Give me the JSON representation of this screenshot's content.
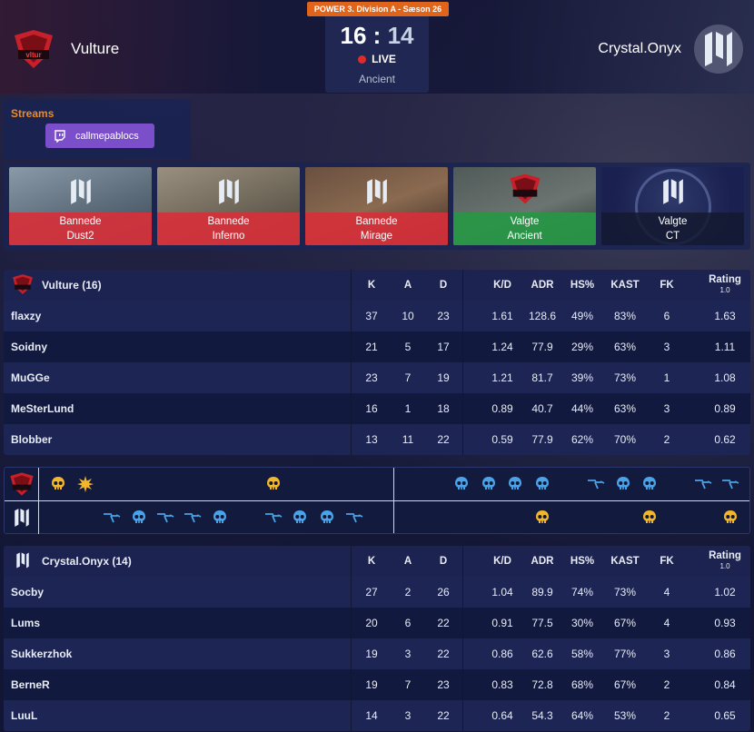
{
  "header": {
    "league": "POWER 3. Division A - Sæson 26",
    "team_left": {
      "name": "Vulture",
      "logo": "vulture-logo"
    },
    "team_right": {
      "name": "Crystal.Onyx",
      "logo": "crystal-onyx-logo"
    },
    "score_left": "16",
    "score_sep": ":",
    "score_right": "14",
    "status": "LIVE",
    "map": "Ancient"
  },
  "streams": {
    "title": "Streams",
    "items": [
      {
        "platform": "twitch-icon",
        "channel": "callmepablocs"
      }
    ]
  },
  "vetoes": [
    {
      "team": "crystal-onyx-logo",
      "action": "Bannede",
      "map": "Dust2",
      "kind": "ban"
    },
    {
      "team": "crystal-onyx-logo",
      "action": "Bannede",
      "map": "Inferno",
      "kind": "ban"
    },
    {
      "team": "crystal-onyx-logo",
      "action": "Bannede",
      "map": "Mirage",
      "kind": "ban"
    },
    {
      "team": "vulture-logo",
      "action": "Valgte",
      "map": "Ancient",
      "kind": "pick"
    },
    {
      "team": "crystal-onyx-logo",
      "action": "Valgte",
      "map": "CT",
      "kind": "side"
    }
  ],
  "columns": [
    "K",
    "A",
    "D",
    "K/D",
    "ADR",
    "HS%",
    "KAST",
    "FK",
    "Rating",
    "1.0"
  ],
  "team1": {
    "title": "Vulture (16)",
    "players": [
      {
        "name": "flaxzy",
        "k": "37",
        "a": "10",
        "d": "23",
        "kd": "1.61",
        "adr": "128.6",
        "hs": "49%",
        "kast": "83%",
        "fk": "6",
        "rating": "1.63"
      },
      {
        "name": "Soidny",
        "k": "21",
        "a": "5",
        "d": "17",
        "kd": "1.24",
        "adr": "77.9",
        "hs": "29%",
        "kast": "63%",
        "fk": "3",
        "rating": "1.11"
      },
      {
        "name": "MuGGe",
        "k": "23",
        "a": "7",
        "d": "19",
        "kd": "1.21",
        "adr": "81.7",
        "hs": "39%",
        "kast": "73%",
        "fk": "1",
        "rating": "1.08"
      },
      {
        "name": "MeSterLund",
        "k": "16",
        "a": "1",
        "d": "18",
        "kd": "0.89",
        "adr": "40.7",
        "hs": "44%",
        "kast": "63%",
        "fk": "3",
        "rating": "0.89"
      },
      {
        "name": "Blobber",
        "k": "13",
        "a": "11",
        "d": "22",
        "kd": "0.59",
        "adr": "77.9",
        "hs": "62%",
        "kast": "70%",
        "fk": "2",
        "rating": "0.62"
      }
    ]
  },
  "team2": {
    "title": "Crystal.Onyx (14)",
    "players": [
      {
        "name": "Socby",
        "k": "27",
        "a": "2",
        "d": "26",
        "kd": "1.04",
        "adr": "89.9",
        "hs": "74%",
        "kast": "73%",
        "fk": "4",
        "rating": "1.02"
      },
      {
        "name": "Lums",
        "k": "20",
        "a": "6",
        "d": "22",
        "kd": "0.91",
        "adr": "77.5",
        "hs": "30%",
        "kast": "67%",
        "fk": "4",
        "rating": "0.93"
      },
      {
        "name": "Sukkerzhok",
        "k": "19",
        "a": "3",
        "d": "22",
        "kd": "0.86",
        "adr": "62.6",
        "hs": "58%",
        "kast": "77%",
        "fk": "3",
        "rating": "0.86"
      },
      {
        "name": "BerneR",
        "k": "19",
        "a": "7",
        "d": "23",
        "kd": "0.83",
        "adr": "72.8",
        "hs": "68%",
        "kast": "67%",
        "fk": "2",
        "rating": "0.84"
      },
      {
        "name": "LuuL",
        "k": "14",
        "a": "3",
        "d": "22",
        "kd": "0.64",
        "adr": "54.3",
        "hs": "64%",
        "kast": "53%",
        "fk": "2",
        "rating": "0.65"
      }
    ]
  },
  "timeline": {
    "colors": {
      "t": "#f2b62a",
      "ct": "#4aa3e8"
    },
    "vulture_rounds": [
      {
        "round": 1,
        "icon": "skull-icon",
        "side": "t"
      },
      {
        "round": 2,
        "icon": "bomb-explosion-icon",
        "side": "t"
      },
      {
        "round": 9,
        "icon": "skull-icon",
        "side": "t"
      },
      {
        "round": 16,
        "icon": "skull-icon",
        "side": "ct"
      },
      {
        "round": 17,
        "icon": "skull-icon",
        "side": "ct"
      },
      {
        "round": 18,
        "icon": "skull-icon",
        "side": "ct"
      },
      {
        "round": 19,
        "icon": "skull-icon",
        "side": "ct"
      },
      {
        "round": 21,
        "icon": "defuse-icon",
        "side": "ct"
      },
      {
        "round": 22,
        "icon": "skull-icon",
        "side": "ct"
      },
      {
        "round": 23,
        "icon": "skull-icon",
        "side": "ct"
      },
      {
        "round": 25,
        "icon": "defuse-icon",
        "side": "ct"
      },
      {
        "round": 26,
        "icon": "defuse-icon",
        "side": "ct"
      }
    ],
    "onyx_rounds": [
      {
        "round": 3,
        "icon": "defuse-icon",
        "side": "ct"
      },
      {
        "round": 4,
        "icon": "skull-icon",
        "side": "ct"
      },
      {
        "round": 5,
        "icon": "defuse-icon",
        "side": "ct"
      },
      {
        "round": 6,
        "icon": "defuse-icon",
        "side": "ct"
      },
      {
        "round": 7,
        "icon": "skull-icon",
        "side": "ct"
      },
      {
        "round": 9,
        "icon": "defuse-icon",
        "side": "ct"
      },
      {
        "round": 10,
        "icon": "skull-icon",
        "side": "ct"
      },
      {
        "round": 11,
        "icon": "skull-icon",
        "side": "ct"
      },
      {
        "round": 12,
        "icon": "defuse-icon",
        "side": "ct"
      },
      {
        "round": 19,
        "icon": "skull-icon",
        "side": "t"
      },
      {
        "round": 23,
        "icon": "skull-icon",
        "side": "t"
      },
      {
        "round": 26,
        "icon": "skull-icon",
        "side": "t"
      }
    ]
  }
}
